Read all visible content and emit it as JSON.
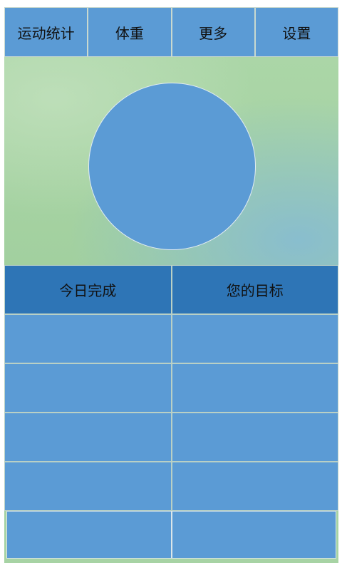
{
  "tabs": [
    {
      "label": "运动统计"
    },
    {
      "label": "体重"
    },
    {
      "label": "更多"
    },
    {
      "label": "设置"
    }
  ],
  "table": {
    "headers": [
      "今日完成",
      "您的目标"
    ],
    "rows": [
      [
        "",
        ""
      ],
      [
        "",
        ""
      ],
      [
        "",
        ""
      ],
      [
        "",
        ""
      ],
      [
        "",
        ""
      ]
    ]
  },
  "colors": {
    "tab_bg": "#5b9bd5",
    "header_bg": "#2e75b6",
    "cell_bg": "#5b9bd5",
    "hero_bg": "#a7d3a4",
    "circle": "#5b9bd5"
  }
}
